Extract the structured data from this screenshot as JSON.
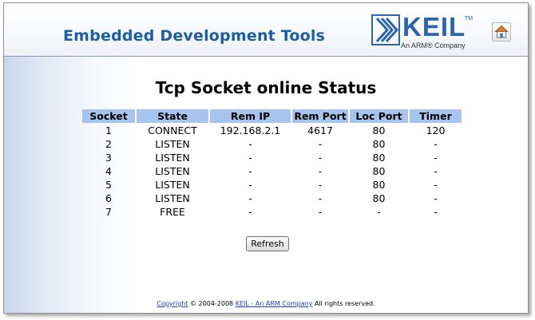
{
  "header": {
    "title": "Embedded Development Tools",
    "logo_word": "KEIL",
    "logo_tm": "TM",
    "logo_sub": "An ARM® Company",
    "home_icon": "home-icon"
  },
  "page": {
    "title": "Tcp Socket online Status"
  },
  "table": {
    "columns": [
      "Socket",
      "State",
      "Rem IP",
      "Rem Port",
      "Loc Port",
      "Timer"
    ],
    "rows": [
      [
        "1",
        "CONNECT",
        "192.168.2.1",
        "4617",
        "80",
        "120"
      ],
      [
        "2",
        "LISTEN",
        "-",
        "-",
        "80",
        "-"
      ],
      [
        "3",
        "LISTEN",
        "-",
        "-",
        "80",
        "-"
      ],
      [
        "4",
        "LISTEN",
        "-",
        "-",
        "80",
        "-"
      ],
      [
        "5",
        "LISTEN",
        "-",
        "-",
        "80",
        "-"
      ],
      [
        "6",
        "LISTEN",
        "-",
        "-",
        "80",
        "-"
      ],
      [
        "7",
        "FREE",
        "-",
        "-",
        "-",
        "-"
      ]
    ]
  },
  "refresh_label": "Refresh",
  "footer": {
    "copyright_link": "Copyright",
    "years": "© 2004-2008",
    "company_link": "KEIL - An ARM Company",
    "rights": "All rights reserved."
  },
  "colors": {
    "title_blue": "#1b5ea8",
    "header_cell": "#a6c4ee",
    "logo_blue": "#2b64b0"
  }
}
